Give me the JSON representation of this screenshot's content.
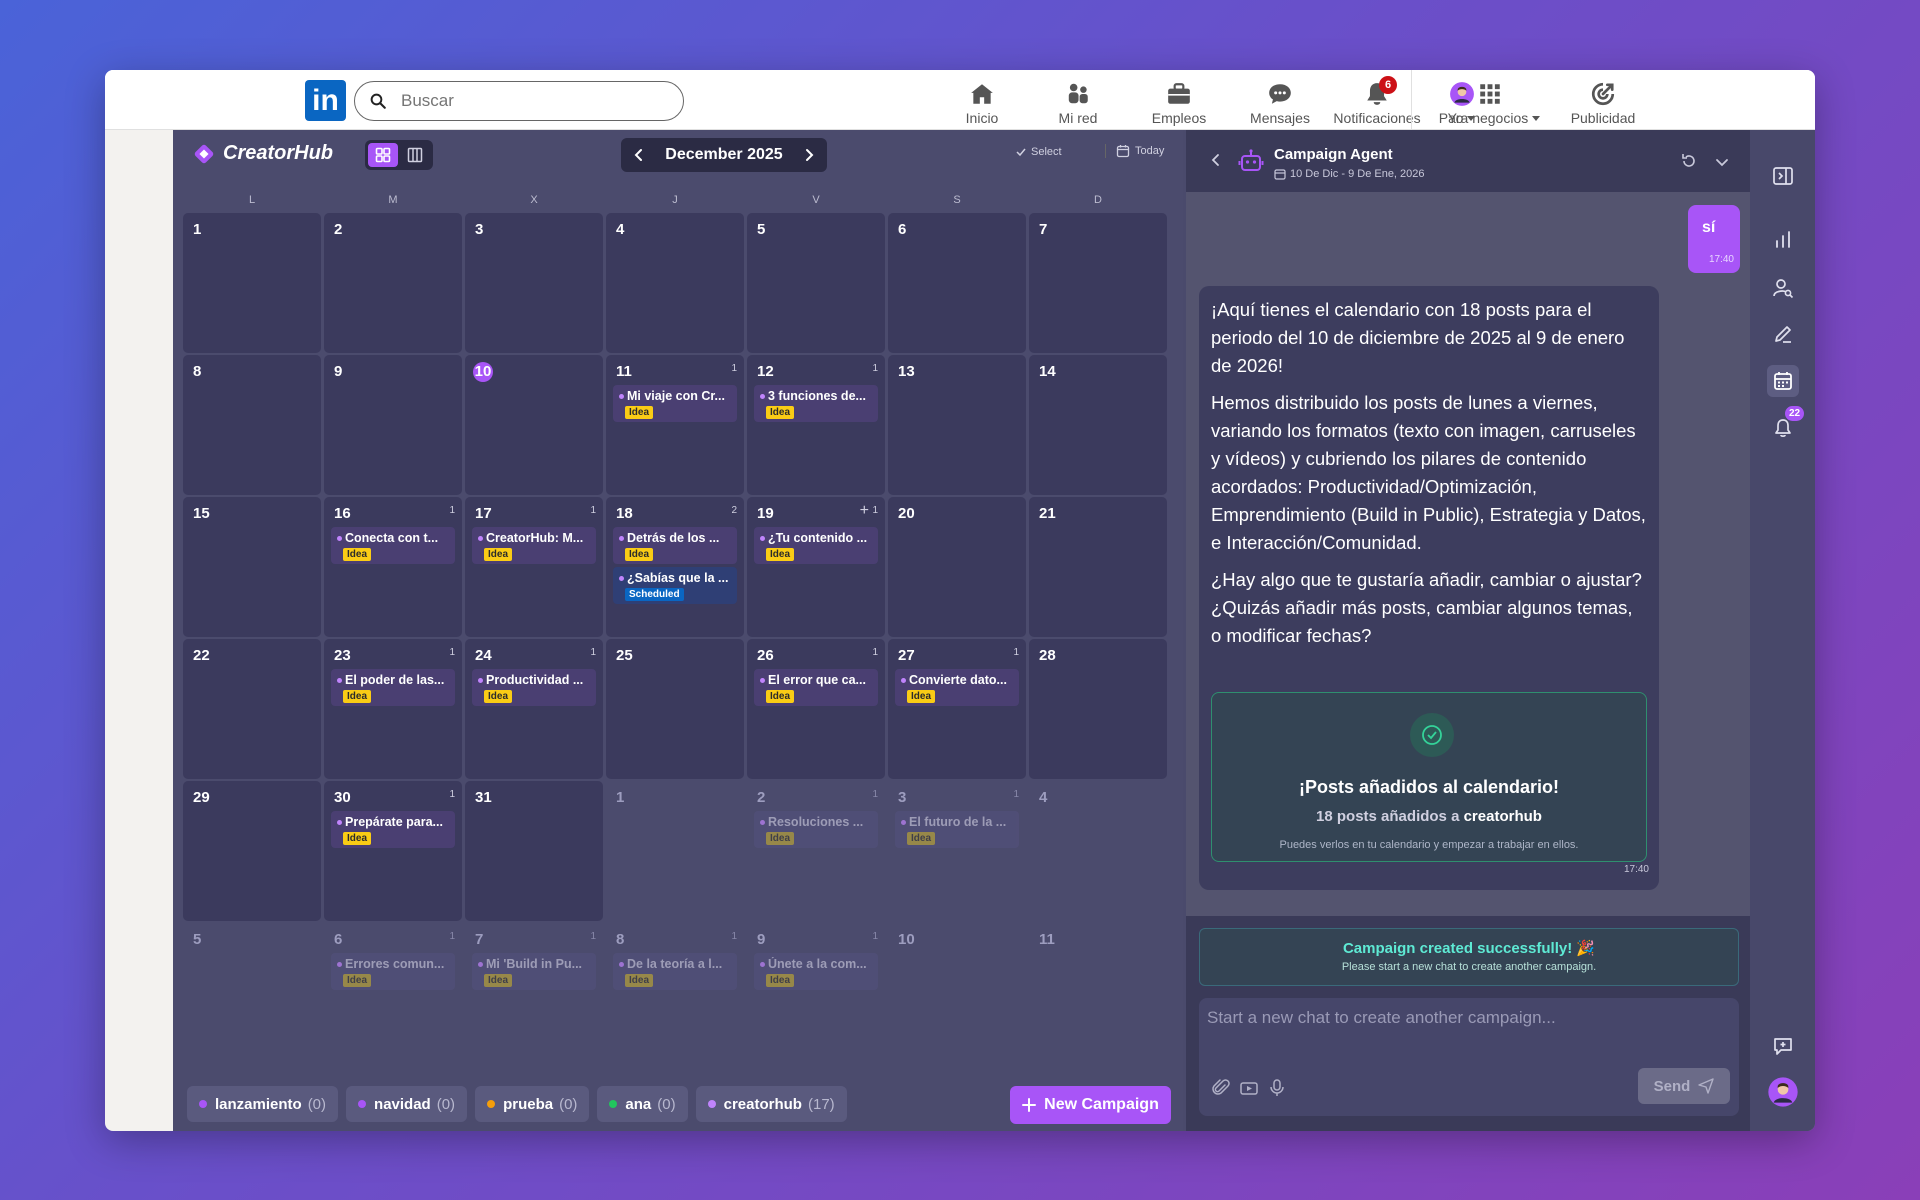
{
  "linkedin": {
    "search_placeholder": "Buscar",
    "nav": [
      {
        "label": "Inicio",
        "icon": "home-icon"
      },
      {
        "label": "Mi red",
        "icon": "network-icon"
      },
      {
        "label": "Empleos",
        "icon": "briefcase-icon"
      },
      {
        "label": "Mensajes",
        "icon": "messages-icon"
      },
      {
        "label": "Notificaciones",
        "icon": "bell-icon",
        "badge": "6"
      },
      {
        "label": "Yo",
        "icon": "avatar"
      },
      {
        "label": "Para negocios",
        "icon": "grid-icon"
      },
      {
        "label": "Publicidad",
        "icon": "ads-icon"
      }
    ]
  },
  "app": {
    "brand": "CreatorHub",
    "month": "December 2025",
    "select_label": "Select",
    "today_label": "Today",
    "weekdays": [
      "L",
      "M",
      "X",
      "J",
      "V",
      "S",
      "D"
    ],
    "cells": [
      {
        "d": "1"
      },
      {
        "d": "2"
      },
      {
        "d": "3"
      },
      {
        "d": "4"
      },
      {
        "d": "5"
      },
      {
        "d": "6"
      },
      {
        "d": "7"
      },
      {
        "d": "8"
      },
      {
        "d": "9"
      },
      {
        "d": "10",
        "today": true
      },
      {
        "d": "11",
        "count": "1",
        "posts": [
          {
            "title": "Mi viaje con Cr...",
            "tag": "Idea"
          }
        ]
      },
      {
        "d": "12",
        "count": "1",
        "posts": [
          {
            "title": "3 funciones de...",
            "tag": "Idea"
          }
        ]
      },
      {
        "d": "13"
      },
      {
        "d": "14"
      },
      {
        "d": "15"
      },
      {
        "d": "16",
        "count": "1",
        "posts": [
          {
            "title": "Conecta con t...",
            "tag": "Idea"
          }
        ]
      },
      {
        "d": "17",
        "count": "1",
        "posts": [
          {
            "title": "CreatorHub: M...",
            "tag": "Idea"
          }
        ]
      },
      {
        "d": "18",
        "count": "2",
        "posts": [
          {
            "title": "Detrás de los ...",
            "tag": "Idea"
          },
          {
            "title": "¿Sabías que la ...",
            "tag": "Scheduled",
            "scheduled": true
          }
        ]
      },
      {
        "d": "19",
        "count": "1",
        "plus": true,
        "posts": [
          {
            "title": "¿Tu contenido ...",
            "tag": "Idea"
          }
        ]
      },
      {
        "d": "20"
      },
      {
        "d": "21"
      },
      {
        "d": "22"
      },
      {
        "d": "23",
        "count": "1",
        "posts": [
          {
            "title": "El poder de las...",
            "tag": "Idea"
          }
        ]
      },
      {
        "d": "24",
        "count": "1",
        "posts": [
          {
            "title": "Productividad ...",
            "tag": "Idea"
          }
        ]
      },
      {
        "d": "25"
      },
      {
        "d": "26",
        "count": "1",
        "posts": [
          {
            "title": "El error que ca...",
            "tag": "Idea"
          }
        ]
      },
      {
        "d": "27",
        "count": "1",
        "posts": [
          {
            "title": "Convierte dato...",
            "tag": "Idea"
          }
        ]
      },
      {
        "d": "28"
      },
      {
        "d": "29"
      },
      {
        "d": "30",
        "count": "1",
        "posts": [
          {
            "title": "Prepárate para...",
            "tag": "Idea"
          }
        ]
      },
      {
        "d": "31"
      },
      {
        "d": "1",
        "faded": true
      },
      {
        "d": "2",
        "faded": true,
        "count": "1",
        "posts": [
          {
            "title": "Resoluciones ...",
            "tag": "Idea"
          }
        ]
      },
      {
        "d": "3",
        "faded": true,
        "count": "1",
        "posts": [
          {
            "title": "El futuro de la ...",
            "tag": "Idea"
          }
        ]
      },
      {
        "d": "4",
        "faded": true
      },
      {
        "d": "5",
        "faded": true
      },
      {
        "d": "6",
        "faded": true,
        "count": "1",
        "posts": [
          {
            "title": "Errores comun...",
            "tag": "Idea"
          }
        ]
      },
      {
        "d": "7",
        "faded": true,
        "count": "1",
        "posts": [
          {
            "title": "Mi 'Build in Pu...",
            "tag": "Idea"
          }
        ]
      },
      {
        "d": "8",
        "faded": true,
        "count": "1",
        "posts": [
          {
            "title": "De la teoría a l...",
            "tag": "Idea"
          }
        ]
      },
      {
        "d": "9",
        "faded": true,
        "count": "1",
        "posts": [
          {
            "title": "Únete a la com...",
            "tag": "Idea"
          }
        ]
      },
      {
        "d": "10",
        "faded": true
      },
      {
        "d": "11",
        "faded": true
      }
    ],
    "chips": [
      {
        "label": "lanzamiento",
        "count": "(0)",
        "color": "#a855f7"
      },
      {
        "label": "navidad",
        "count": "(0)",
        "color": "#a855f7"
      },
      {
        "label": "prueba",
        "count": "(0)",
        "color": "#f59e0b"
      },
      {
        "label": "ana",
        "count": "(0)",
        "color": "#22c55e"
      },
      {
        "label": "creatorhub",
        "count": "(17)",
        "color": "#c084fc"
      }
    ],
    "new_campaign_label": "New Campaign"
  },
  "agent": {
    "title": "Campaign Agent",
    "dates": "10 De Dic - 9 De Ene, 2026",
    "user_message": "sí",
    "user_time": "17:40",
    "ai_paragraphs": [
      "¡Aquí tienes el calendario con 18 posts para el periodo del 10 de diciembre de 2025 al 9 de enero de 2026!",
      "Hemos distribuido los posts de lunes a viernes, variando los formatos (texto con imagen, carruseles y vídeos) y cubriendo los pilares de contenido acordados: Productividad/Optimización, Emprendimiento (Build in Public), Estrategia y Datos, e Interacción/Comunidad.",
      "¿Hay algo que te gustaría añadir, cambiar o ajustar? ¿Quizás añadir más posts, cambiar algunos temas, o modificar fechas?"
    ],
    "added_title": "¡Posts añadidos al calendario!",
    "added_sub_prefix": "18 posts añadidos a",
    "added_sub_target": "creatorhub",
    "added_note": "Puedes verlos en tu calendario y empezar a trabajar en ellos.",
    "ai_time": "17:40",
    "success_title": "Campaign created successfully! 🎉",
    "success_sub": "Please start a new chat to create another campaign.",
    "chat_placeholder": "Start a new chat to create another campaign...",
    "send_label": "Send"
  },
  "rail": {
    "notification_badge": "22"
  },
  "colors": {
    "accent": "#a855f7",
    "linkedin_blue": "#0a66c2",
    "idea_tag": "#facc15",
    "success": "#5eead4"
  }
}
